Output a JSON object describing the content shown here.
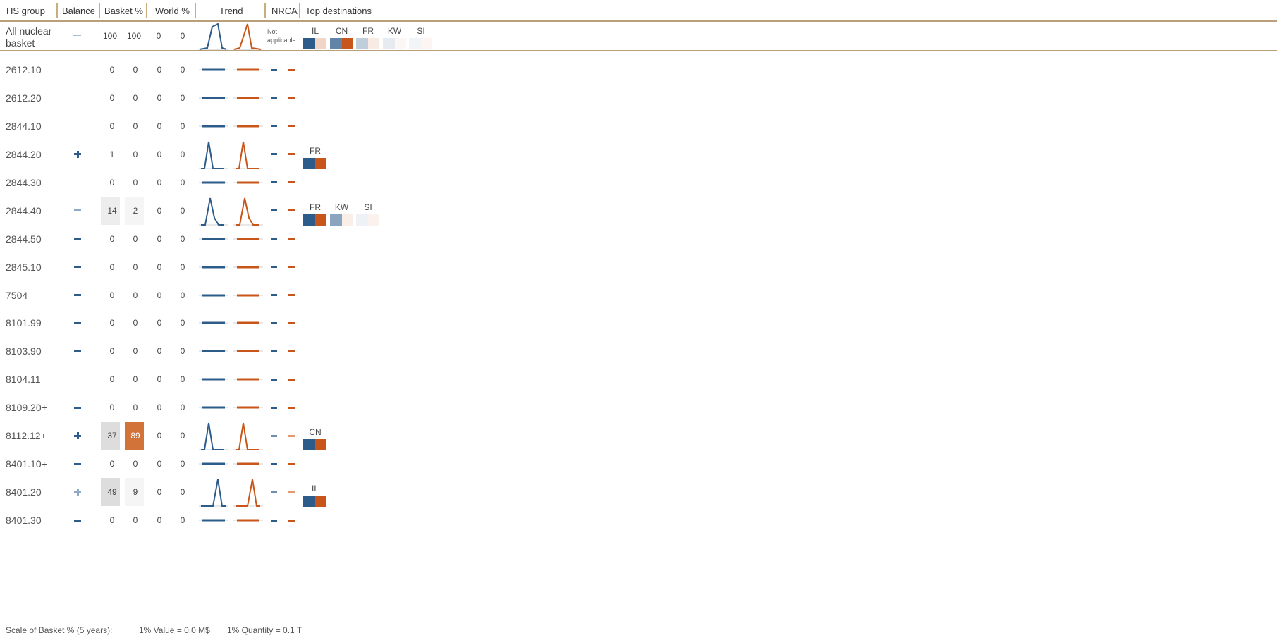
{
  "header": {
    "hs_group": "HS group",
    "balance": "Balance",
    "basket": "Basket %",
    "world": "World %",
    "trend": "Trend",
    "nrca": "NRCA",
    "top_destinations": "Top destinations"
  },
  "colors": {
    "blue": "#2e5c8a",
    "orange": "#c8561a",
    "accent_line": "#b9a07a",
    "light_gray_box": "#ececec",
    "mid_gray_box": "#dcdcdc"
  },
  "summary": {
    "label": "All nuclear basket",
    "label_line1": "All nuclear",
    "label_line2": "basket",
    "balance": "minus-light",
    "basket_exp": "100",
    "basket_imp": "100",
    "world_exp": "0",
    "world_imp": "0",
    "trend": "peak",
    "nrca_text_1": "Not",
    "nrca_text_2": "applicable",
    "destinations": [
      {
        "code": "IL",
        "exp_share": 1.0,
        "imp_share": 0.25
      },
      {
        "code": "CN",
        "exp_share": 0.75,
        "imp_share": 1.0
      },
      {
        "code": "FR",
        "exp_share": 0.3,
        "imp_share": 0.12
      },
      {
        "code": "KW",
        "exp_share": 0.12,
        "imp_share": 0.05
      },
      {
        "code": "SI",
        "exp_share": 0.06,
        "imp_share": 0.06
      }
    ]
  },
  "rows": [
    {
      "code": "2612.10",
      "balance": "",
      "basket_exp": "0",
      "basket_imp": "0",
      "world_exp": "0",
      "world_imp": "0",
      "trend": "flat",
      "nrca": "dark",
      "destinations": []
    },
    {
      "code": "2612.20",
      "balance": "",
      "basket_exp": "0",
      "basket_imp": "0",
      "world_exp": "0",
      "world_imp": "0",
      "trend": "flat",
      "nrca": "dark",
      "destinations": []
    },
    {
      "code": "2844.10",
      "balance": "",
      "basket_exp": "0",
      "basket_imp": "0",
      "world_exp": "0",
      "world_imp": "0",
      "trend": "flat",
      "nrca": "dark",
      "destinations": []
    },
    {
      "code": "2844.20",
      "balance": "plus",
      "basket_exp": "1",
      "basket_imp": "0",
      "world_exp": "0",
      "world_imp": "0",
      "trend": "peak",
      "nrca": "dark",
      "destinations": [
        {
          "code": "FR",
          "exp_share": 1.0,
          "imp_share": 1.0
        }
      ]
    },
    {
      "code": "2844.30",
      "balance": "",
      "basket_exp": "0",
      "basket_imp": "0",
      "world_exp": "0",
      "world_imp": "0",
      "trend": "flat",
      "nrca": "dark",
      "destinations": []
    },
    {
      "code": "2844.40",
      "balance": "minus-light",
      "basket_exp": "14",
      "basket_imp": "2",
      "world_exp": "0",
      "world_imp": "0",
      "trend": "peak-tail",
      "nrca": "dark",
      "box_exp": "light",
      "box_imp": "faint",
      "destinations": [
        {
          "code": "FR",
          "exp_share": 1.0,
          "imp_share": 1.0
        },
        {
          "code": "KW",
          "exp_share": 0.55,
          "imp_share": 0.1
        },
        {
          "code": "SI",
          "exp_share": 0.08,
          "imp_share": 0.08
        }
      ]
    },
    {
      "code": "2844.50",
      "balance": "minus",
      "basket_exp": "0",
      "basket_imp": "0",
      "world_exp": "0",
      "world_imp": "0",
      "trend": "flat",
      "nrca": "dark",
      "destinations": []
    },
    {
      "code": "2845.10",
      "balance": "minus",
      "basket_exp": "0",
      "basket_imp": "0",
      "world_exp": "0",
      "world_imp": "0",
      "trend": "flat",
      "nrca": "dark",
      "destinations": []
    },
    {
      "code": "7504",
      "balance": "minus",
      "basket_exp": "0",
      "basket_imp": "0",
      "world_exp": "0",
      "world_imp": "0",
      "trend": "flat",
      "nrca": "dark",
      "destinations": []
    },
    {
      "code": "8101.99",
      "balance": "minus",
      "basket_exp": "0",
      "basket_imp": "0",
      "world_exp": "0",
      "world_imp": "0",
      "trend": "flat",
      "nrca": "dark",
      "destinations": []
    },
    {
      "code": "8103.90",
      "balance": "minus",
      "basket_exp": "0",
      "basket_imp": "0",
      "world_exp": "0",
      "world_imp": "0",
      "trend": "flat",
      "nrca": "dark",
      "destinations": []
    },
    {
      "code": "8104.11",
      "balance": "",
      "basket_exp": "0",
      "basket_imp": "0",
      "world_exp": "0",
      "world_imp": "0",
      "trend": "flat",
      "nrca": "dark",
      "destinations": []
    },
    {
      "code": "8109.20+",
      "balance": "minus",
      "basket_exp": "0",
      "basket_imp": "0",
      "world_exp": "0",
      "world_imp": "0",
      "trend": "flat",
      "nrca": "dark",
      "destinations": []
    },
    {
      "code": "8112.12+",
      "balance": "plus",
      "basket_exp": "37",
      "basket_imp": "89",
      "world_exp": "0",
      "world_imp": "0",
      "trend": "peak",
      "nrca": "light",
      "box_exp": "mid",
      "box_imp": "orange",
      "destinations": [
        {
          "code": "CN",
          "exp_share": 1.0,
          "imp_share": 1.0
        }
      ]
    },
    {
      "code": "8401.10+",
      "balance": "minus",
      "basket_exp": "0",
      "basket_imp": "0",
      "world_exp": "0",
      "world_imp": "0",
      "trend": "flat",
      "nrca": "dark",
      "destinations": []
    },
    {
      "code": "8401.20",
      "balance": "plus-light",
      "basket_exp": "49",
      "basket_imp": "9",
      "world_exp": "0",
      "world_imp": "0",
      "trend": "peak-late",
      "nrca": "light",
      "box_exp": "mid",
      "box_imp": "faint",
      "destinations": [
        {
          "code": "IL",
          "exp_share": 1.0,
          "imp_share": 1.0
        }
      ]
    },
    {
      "code": "8401.30",
      "balance": "minus",
      "basket_exp": "0",
      "basket_imp": "0",
      "world_exp": "0",
      "world_imp": "0",
      "trend": "flat",
      "nrca": "dark",
      "destinations": []
    }
  ],
  "footer": {
    "scale_label": "Scale of Basket % (5 years):",
    "value_note": "1% Value = 0.0 M$",
    "quantity_note": "1% Quantity = 0.1 T"
  }
}
